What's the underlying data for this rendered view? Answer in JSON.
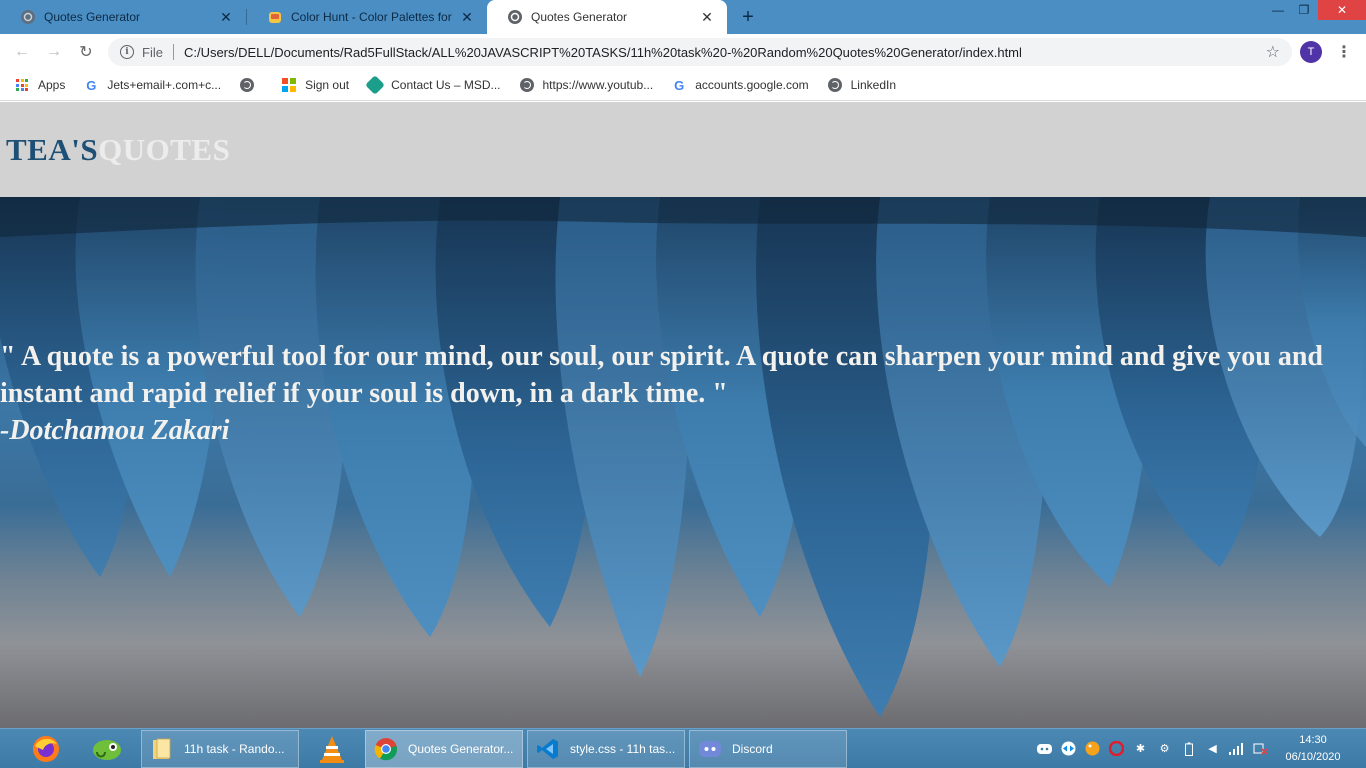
{
  "browser": {
    "tabs": [
      {
        "title": "Quotes Generator",
        "active": false
      },
      {
        "title": "Color Hunt - Color Palettes for Designers and Artists",
        "active": false
      },
      {
        "title": "Quotes Generator",
        "active": true
      }
    ],
    "new_tab_label": "+",
    "address": {
      "scheme": "File",
      "url": "C:/Users/DELL/Documents/Rad5FullStack/ALL%20JAVASCRIPT%20TASKS/11h%20task%20-%20Random%20Quotes%20Generator/index.html"
    },
    "profile_initial": "T",
    "bookmarks": [
      {
        "label": "Apps",
        "icon": "apps-grid-icon"
      },
      {
        "label": "Jets+email+.com+c...",
        "icon": "google-icon"
      },
      {
        "label": "",
        "icon": "globe-icon"
      },
      {
        "label": "Sign out",
        "icon": "microsoft-icon"
      },
      {
        "label": "Contact Us – MSD...",
        "icon": "msd-icon"
      },
      {
        "label": "https://www.youtub...",
        "icon": "globe-icon"
      },
      {
        "label": "accounts.google.com",
        "icon": "google-icon"
      },
      {
        "label": "LinkedIn",
        "icon": "globe-icon"
      }
    ]
  },
  "page": {
    "brand_part1": "TEA'S",
    "brand_part2": "QUOTES",
    "quote": "\" A quote is a powerful tool for our mind, our soul, our spirit. A quote can sharpen your mind and give you and instant and rapid relief if your soul is down, in a dark time. \"",
    "author": "-Dotchamou Zakari",
    "colors": {
      "brand_dark": "#1e4f74",
      "brand_light": "#ececec",
      "header_bg": "#d2d2d2",
      "quote_text": "#f2f1ee"
    }
  },
  "taskbar": {
    "pinned": [
      "firefox-icon",
      "chameleon-icon"
    ],
    "buttons": [
      {
        "label": "11h task - Rando...",
        "icon": "folder-icon",
        "active": false
      },
      {
        "label": "",
        "icon": "vlc-icon",
        "active": false
      },
      {
        "label": "Quotes Generator...",
        "icon": "chrome-icon",
        "active": true
      },
      {
        "label": "style.css - 11h tas...",
        "icon": "vscode-icon",
        "active": false
      },
      {
        "label": "Discord",
        "icon": "discord-icon",
        "active": false
      }
    ],
    "tray": [
      "discord-tray-icon",
      "teamviewer-icon",
      "paint-icon",
      "opera-icon",
      "bluetooth-icon",
      "device-icon",
      "battery-icon",
      "volume-icon",
      "signal-icon",
      "network-icon"
    ],
    "time": "14:30",
    "date": "06/10/2020"
  }
}
